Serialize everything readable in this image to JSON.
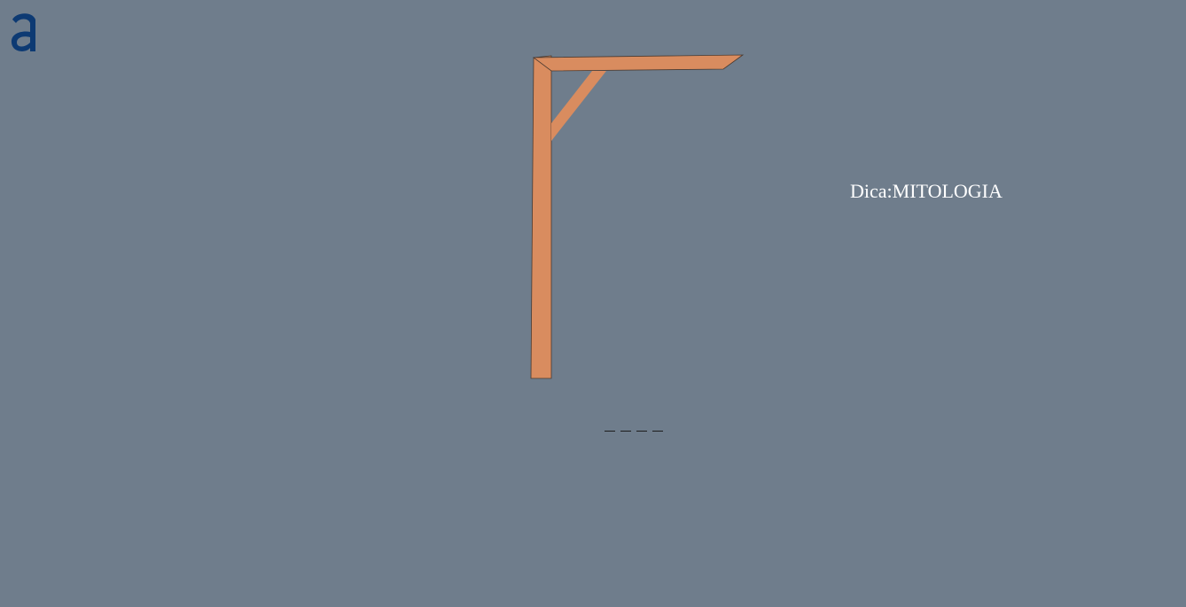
{
  "logo": {
    "icon": "a-logo-icon",
    "color": "#0d3a73"
  },
  "game": {
    "hint_label": "Dica:",
    "hint_value": "MITOLOGIA",
    "word_slots": [
      "",
      "",
      "",
      ""
    ],
    "errors": 0
  },
  "colors": {
    "background": "#6f7d8c",
    "gallows_wood": "#d98c5f",
    "gallows_outline": "#4a3a30",
    "hint_text": "#ffffff"
  }
}
